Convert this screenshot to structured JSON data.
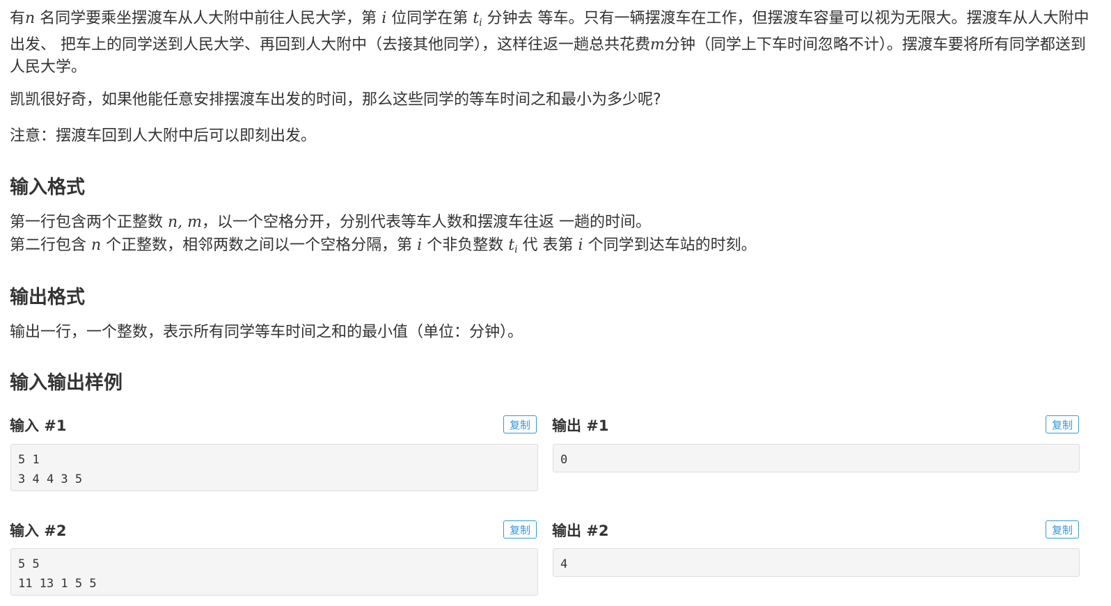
{
  "problem": {
    "para1": {
      "t1": "有",
      "m1": "n",
      "t2": " 名同学要乘坐摆渡车从人大附中前往人民大学，第 ",
      "m2": "i",
      "t3": " 位同学在第 ",
      "m3": "t",
      "m3sub": "i",
      "t4": " 分钟去 等车。只有一辆摆渡车在工作，但摆渡车容量可以视为无限大。摆渡车从人大附中出发、 把车上的同学送到人民大学、再回到人大附中（去接其他同学），这样往返一趟总共花费",
      "m4": "m",
      "t5": "分钟（同学上下车时间忽略不计）。摆渡车要将所有同学都送到人民大学。"
    },
    "para2": "凯凯很好奇，如果他能任意安排摆渡车出发的时间，那么这些同学的等车时间之和最小为多少呢?",
    "para3": "注意：摆渡车回到人大附中后可以即刻出发。"
  },
  "input_format": {
    "heading": "输入格式",
    "line1_a": "第一行包含两个正整数 ",
    "line1_m": "n, m",
    "line1_b": "，以一个空格分开，分别代表等车人数和摆渡车往返 一趟的时间。",
    "line2_a": "第二行包含 ",
    "line2_m1": "n",
    "line2_b": " 个正整数，相邻两数之间以一个空格分隔，第 ",
    "line2_m2": "i",
    "line2_c": " 个非负整数 ",
    "line2_m3": "t",
    "line2_m3sub": "i",
    "line2_d": " 代 表第 ",
    "line2_m4": "i",
    "line2_e": " 个同学到达车站的时刻。"
  },
  "output_format": {
    "heading": "输出格式",
    "text": "输出一行，一个整数，表示所有同学等车时间之和的最小值（单位：分钟）。"
  },
  "samples": {
    "heading": "输入输出样例",
    "copy_label": "复制",
    "items": [
      {
        "input_label": "输入 #1",
        "input": "5 1\n3 4 4 3 5",
        "output_label": "输出 #1",
        "output": "0"
      },
      {
        "input_label": "输入 #2",
        "input": "5 5\n11 13 1 5 5",
        "output_label": "输出 #2",
        "output": "4"
      }
    ]
  }
}
